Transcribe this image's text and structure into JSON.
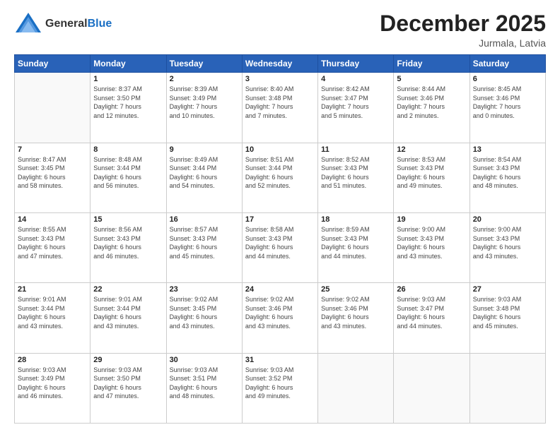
{
  "header": {
    "logo_general": "General",
    "logo_blue": "Blue",
    "month_title": "December 2025",
    "subtitle": "Jurmala, Latvia"
  },
  "days_of_week": [
    "Sunday",
    "Monday",
    "Tuesday",
    "Wednesday",
    "Thursday",
    "Friday",
    "Saturday"
  ],
  "weeks": [
    [
      {
        "day": "",
        "info": ""
      },
      {
        "day": "1",
        "info": "Sunrise: 8:37 AM\nSunset: 3:50 PM\nDaylight: 7 hours\nand 12 minutes."
      },
      {
        "day": "2",
        "info": "Sunrise: 8:39 AM\nSunset: 3:49 PM\nDaylight: 7 hours\nand 10 minutes."
      },
      {
        "day": "3",
        "info": "Sunrise: 8:40 AM\nSunset: 3:48 PM\nDaylight: 7 hours\nand 7 minutes."
      },
      {
        "day": "4",
        "info": "Sunrise: 8:42 AM\nSunset: 3:47 PM\nDaylight: 7 hours\nand 5 minutes."
      },
      {
        "day": "5",
        "info": "Sunrise: 8:44 AM\nSunset: 3:46 PM\nDaylight: 7 hours\nand 2 minutes."
      },
      {
        "day": "6",
        "info": "Sunrise: 8:45 AM\nSunset: 3:46 PM\nDaylight: 7 hours\nand 0 minutes."
      }
    ],
    [
      {
        "day": "7",
        "info": "Sunrise: 8:47 AM\nSunset: 3:45 PM\nDaylight: 6 hours\nand 58 minutes."
      },
      {
        "day": "8",
        "info": "Sunrise: 8:48 AM\nSunset: 3:44 PM\nDaylight: 6 hours\nand 56 minutes."
      },
      {
        "day": "9",
        "info": "Sunrise: 8:49 AM\nSunset: 3:44 PM\nDaylight: 6 hours\nand 54 minutes."
      },
      {
        "day": "10",
        "info": "Sunrise: 8:51 AM\nSunset: 3:44 PM\nDaylight: 6 hours\nand 52 minutes."
      },
      {
        "day": "11",
        "info": "Sunrise: 8:52 AM\nSunset: 3:43 PM\nDaylight: 6 hours\nand 51 minutes."
      },
      {
        "day": "12",
        "info": "Sunrise: 8:53 AM\nSunset: 3:43 PM\nDaylight: 6 hours\nand 49 minutes."
      },
      {
        "day": "13",
        "info": "Sunrise: 8:54 AM\nSunset: 3:43 PM\nDaylight: 6 hours\nand 48 minutes."
      }
    ],
    [
      {
        "day": "14",
        "info": "Sunrise: 8:55 AM\nSunset: 3:43 PM\nDaylight: 6 hours\nand 47 minutes."
      },
      {
        "day": "15",
        "info": "Sunrise: 8:56 AM\nSunset: 3:43 PM\nDaylight: 6 hours\nand 46 minutes."
      },
      {
        "day": "16",
        "info": "Sunrise: 8:57 AM\nSunset: 3:43 PM\nDaylight: 6 hours\nand 45 minutes."
      },
      {
        "day": "17",
        "info": "Sunrise: 8:58 AM\nSunset: 3:43 PM\nDaylight: 6 hours\nand 44 minutes."
      },
      {
        "day": "18",
        "info": "Sunrise: 8:59 AM\nSunset: 3:43 PM\nDaylight: 6 hours\nand 44 minutes."
      },
      {
        "day": "19",
        "info": "Sunrise: 9:00 AM\nSunset: 3:43 PM\nDaylight: 6 hours\nand 43 minutes."
      },
      {
        "day": "20",
        "info": "Sunrise: 9:00 AM\nSunset: 3:43 PM\nDaylight: 6 hours\nand 43 minutes."
      }
    ],
    [
      {
        "day": "21",
        "info": "Sunrise: 9:01 AM\nSunset: 3:44 PM\nDaylight: 6 hours\nand 43 minutes."
      },
      {
        "day": "22",
        "info": "Sunrise: 9:01 AM\nSunset: 3:44 PM\nDaylight: 6 hours\nand 43 minutes."
      },
      {
        "day": "23",
        "info": "Sunrise: 9:02 AM\nSunset: 3:45 PM\nDaylight: 6 hours\nand 43 minutes."
      },
      {
        "day": "24",
        "info": "Sunrise: 9:02 AM\nSunset: 3:46 PM\nDaylight: 6 hours\nand 43 minutes."
      },
      {
        "day": "25",
        "info": "Sunrise: 9:02 AM\nSunset: 3:46 PM\nDaylight: 6 hours\nand 43 minutes."
      },
      {
        "day": "26",
        "info": "Sunrise: 9:03 AM\nSunset: 3:47 PM\nDaylight: 6 hours\nand 44 minutes."
      },
      {
        "day": "27",
        "info": "Sunrise: 9:03 AM\nSunset: 3:48 PM\nDaylight: 6 hours\nand 45 minutes."
      }
    ],
    [
      {
        "day": "28",
        "info": "Sunrise: 9:03 AM\nSunset: 3:49 PM\nDaylight: 6 hours\nand 46 minutes."
      },
      {
        "day": "29",
        "info": "Sunrise: 9:03 AM\nSunset: 3:50 PM\nDaylight: 6 hours\nand 47 minutes."
      },
      {
        "day": "30",
        "info": "Sunrise: 9:03 AM\nSunset: 3:51 PM\nDaylight: 6 hours\nand 48 minutes."
      },
      {
        "day": "31",
        "info": "Sunrise: 9:03 AM\nSunset: 3:52 PM\nDaylight: 6 hours\nand 49 minutes."
      },
      {
        "day": "",
        "info": ""
      },
      {
        "day": "",
        "info": ""
      },
      {
        "day": "",
        "info": ""
      }
    ]
  ]
}
